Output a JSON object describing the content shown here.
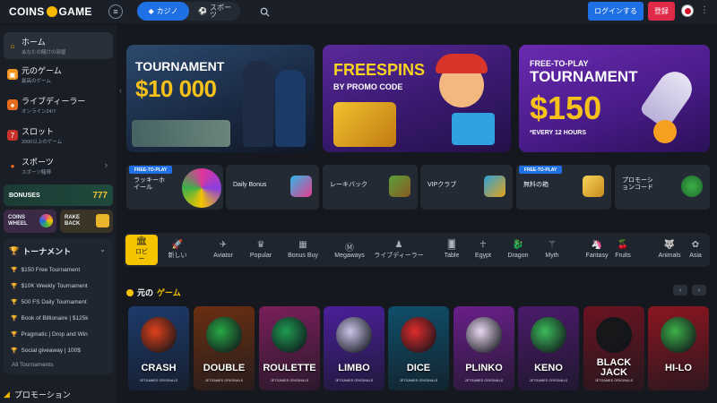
{
  "header": {
    "logo_left": "COINS",
    "logo_right": "GAME",
    "tabs": [
      {
        "label": "カジノ",
        "active": true
      },
      {
        "label": "スポーツ",
        "active": false
      }
    ],
    "login_label": "ログインする",
    "register_label": "登録"
  },
  "sidebar": {
    "items": [
      {
        "label": "ホーム",
        "sub": "あなたの賭けの部屋",
        "active": true
      },
      {
        "label": "元のゲーム",
        "sub": "最高のゲーム"
      },
      {
        "label": "ライブディーラー",
        "sub": "オンライン24/7"
      },
      {
        "label": "スロット",
        "sub": "2000以上のゲーム"
      },
      {
        "label": "スポーツ",
        "sub": "スポーツ賭博"
      }
    ],
    "bonuses_label": "BONUSES",
    "bonuses_slot": "777",
    "coins_wheel": "COINS\nWHEEL",
    "rake_back": "RAKE\nBACK",
    "tournaments_title": "トーナメント",
    "tournaments": [
      "$150 Free Tournament",
      "$10K Weekly Tournament",
      "500 FS Daily Tournament",
      "Book of Billionaire | $125k",
      "Pragmatic | Drop and Win",
      "Social giveaway | 100$"
    ],
    "all_tournaments": "All Tournaments",
    "promotion": "プロモーション"
  },
  "banners": [
    {
      "title": "TOURNAMENT",
      "big": "$10 000"
    },
    {
      "title": "FREESPINS",
      "sub": "BY PROMO CODE"
    },
    {
      "title": "FREE-TO-PLAY",
      "title2": "TOURNAMENT",
      "big": "$150",
      "sub": "*EVERY 12 HOURS"
    }
  ],
  "promos": [
    {
      "label": "ラッキーホ\nイール",
      "tag": "FREE-TO-PLAY"
    },
    {
      "label": "Daily Bonus"
    },
    {
      "label": "レーキバック"
    },
    {
      "label": "VIPクラブ"
    },
    {
      "label": "無料の箱",
      "tag": "FREE-TO-PLAY"
    },
    {
      "label": "プロモーシ\nョンコード"
    }
  ],
  "categories": [
    {
      "label": "ロビ\nー",
      "icon": "building-icon",
      "active": true
    },
    {
      "label": "新しい",
      "icon": "rocket-icon"
    },
    {
      "label": "Aviator",
      "icon": "plane-icon"
    },
    {
      "label": "Popular",
      "icon": "crown-icon"
    },
    {
      "label": "Bonus Buy",
      "icon": "grid-icon"
    },
    {
      "label": "Megaways",
      "icon": "mega-icon"
    },
    {
      "label": "ライブディーラー",
      "icon": "dealer-icon"
    },
    {
      "label": "Table",
      "icon": "cards-icon"
    },
    {
      "label": "Egypt",
      "icon": "ankh-icon"
    },
    {
      "label": "Dragon",
      "icon": "dragon-icon"
    },
    {
      "label": "Myth",
      "icon": "myth-icon"
    },
    {
      "label": "Fantasy",
      "icon": "unicorn-icon"
    },
    {
      "label": "Fruits",
      "icon": "fruit-icon"
    },
    {
      "label": "Animals",
      "icon": "wolf-icon"
    },
    {
      "label": "Asia",
      "icon": "lotus-icon"
    }
  ],
  "section": {
    "title_a": "元の",
    "title_b": "ゲーム"
  },
  "games": [
    {
      "name": "CRASH",
      "sub": "JETGAMES ORIGINALS",
      "color": "#1d3a6a",
      "art": "#e0421c"
    },
    {
      "name": "DOUBLE",
      "sub": "JETGAMES ORIGINALS",
      "color": "#6a2f12",
      "art": "#29a845"
    },
    {
      "name": "ROULETTE",
      "sub": "JETGAMES ORIGINALS",
      "color": "#7a1f5a",
      "art": "#1f9b52"
    },
    {
      "name": "LIMBO",
      "sub": "JETGAMES ORIGINALS",
      "color": "#4a1f9a",
      "art": "#c9c4e8"
    },
    {
      "name": "DICE",
      "sub": "JETGAMES ORIGINALS",
      "color": "#0f4f6a",
      "art": "#e02c2c"
    },
    {
      "name": "PLINKO",
      "sub": "JETGAMES ORIGINALS",
      "color": "#6a1f8a",
      "art": "#ead8f0"
    },
    {
      "name": "KENO",
      "sub": "JETGAMES ORIGINALS",
      "color": "#4a1a6a",
      "art": "#3dbb5a"
    },
    {
      "name": "BLACK\nJACK",
      "sub": "JETGAMES ORIGINALS",
      "color": "#6a1420",
      "art": "#1a1a1a"
    },
    {
      "name": "HI-LO",
      "sub": "",
      "color": "#8a1620",
      "art": "#3db048"
    }
  ]
}
